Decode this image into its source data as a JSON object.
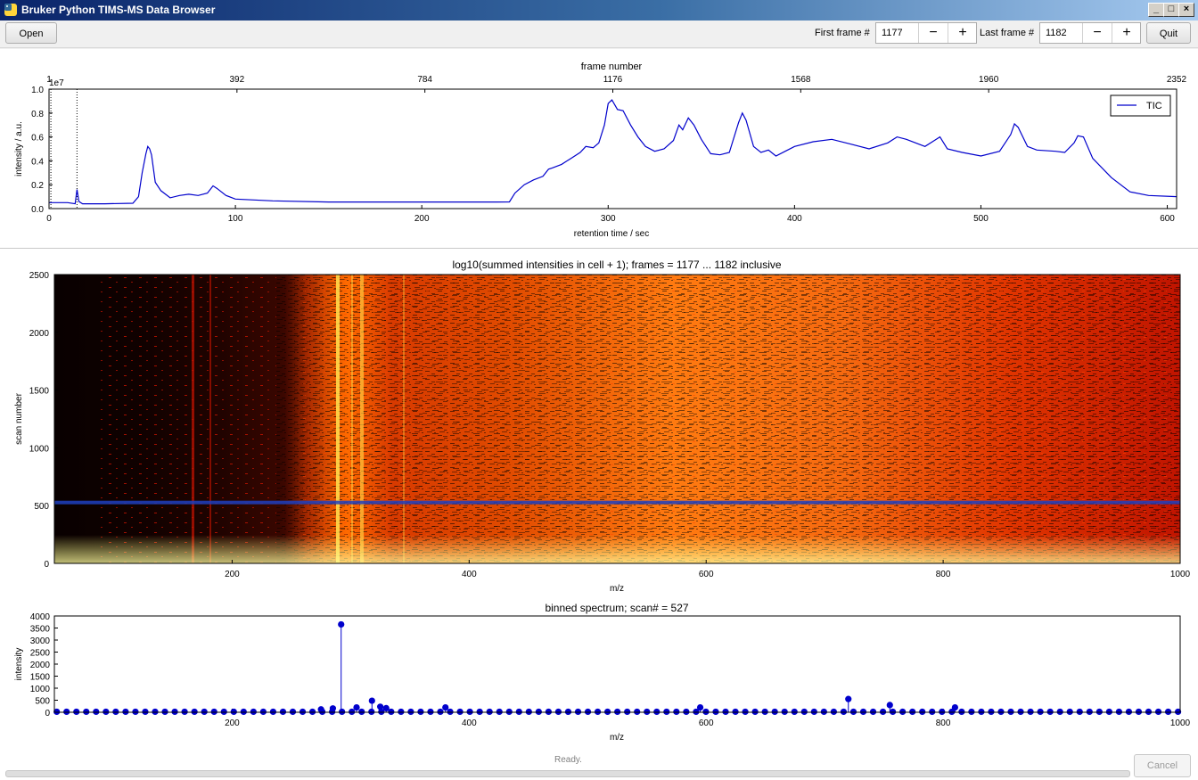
{
  "window": {
    "title": "Bruker Python TIMS-MS Data Browser"
  },
  "toolbar": {
    "open_label": "Open",
    "first_frame_label": "First frame #",
    "first_frame_value": "1177",
    "last_frame_label": "Last frame #",
    "last_frame_value": "1182",
    "minus": "−",
    "plus": "+",
    "quit_label": "Quit"
  },
  "tic_chart": {
    "type": "line",
    "top_xlabel": "frame number",
    "top_ticks": [
      "1",
      "392",
      "784",
      "1176",
      "1568",
      "1960",
      "2352"
    ],
    "xlabel": "retention time / sec",
    "ylabel": "intensity / a.u.",
    "y_scale_label": "1e7",
    "xlim": [
      0,
      605
    ],
    "ylim": [
      0,
      1.0
    ],
    "x_ticks": [
      "0",
      "100",
      "200",
      "300",
      "400",
      "500",
      "600"
    ],
    "y_ticks": [
      "0.0",
      "0.2",
      "0.4",
      "0.6",
      "0.8",
      "1.0"
    ],
    "legend": "TIC",
    "legend_position": "top-right",
    "color": "#0000cc",
    "marker_lines": [
      1,
      15
    ],
    "x": [
      0,
      10,
      14,
      15,
      16,
      18,
      30,
      45,
      48,
      50,
      52,
      53,
      54,
      55,
      57,
      60,
      65,
      70,
      75,
      80,
      85,
      88,
      90,
      95,
      100,
      120,
      150,
      200,
      240,
      247,
      250,
      255,
      260,
      265,
      268,
      270,
      275,
      280,
      285,
      288,
      292,
      295,
      298,
      300,
      302,
      305,
      308,
      312,
      316,
      320,
      325,
      330,
      335,
      338,
      340,
      343,
      346,
      350,
      355,
      360,
      365,
      370,
      372,
      374,
      378,
      382,
      386,
      390,
      395,
      400,
      410,
      420,
      430,
      440,
      450,
      455,
      460,
      470,
      475,
      478,
      482,
      490,
      500,
      510,
      516,
      518,
      520,
      525,
      530,
      540,
      545,
      550,
      552,
      555,
      560,
      570,
      580,
      590,
      605
    ],
    "y": [
      0.05,
      0.05,
      0.04,
      0.16,
      0.06,
      0.04,
      0.04,
      0.045,
      0.1,
      0.3,
      0.46,
      0.52,
      0.5,
      0.45,
      0.22,
      0.15,
      0.09,
      0.11,
      0.12,
      0.11,
      0.13,
      0.19,
      0.17,
      0.11,
      0.08,
      0.065,
      0.055,
      0.055,
      0.055,
      0.056,
      0.13,
      0.2,
      0.24,
      0.27,
      0.33,
      0.34,
      0.37,
      0.42,
      0.47,
      0.52,
      0.51,
      0.55,
      0.7,
      0.88,
      0.91,
      0.83,
      0.82,
      0.7,
      0.6,
      0.52,
      0.48,
      0.5,
      0.57,
      0.7,
      0.66,
      0.76,
      0.7,
      0.58,
      0.46,
      0.45,
      0.47,
      0.72,
      0.8,
      0.74,
      0.52,
      0.47,
      0.49,
      0.44,
      0.48,
      0.52,
      0.56,
      0.58,
      0.54,
      0.5,
      0.55,
      0.6,
      0.58,
      0.52,
      0.57,
      0.6,
      0.5,
      0.47,
      0.44,
      0.48,
      0.62,
      0.71,
      0.68,
      0.52,
      0.49,
      0.48,
      0.47,
      0.55,
      0.61,
      0.6,
      0.42,
      0.26,
      0.14,
      0.11,
      0.1
    ]
  },
  "heatmap_chart": {
    "type": "heatmap",
    "title": "log10(summed intensities in cell + 1); frames = 1177 ... 1182 inclusive",
    "xlabel": "m/z",
    "ylabel": "scan number",
    "xlim": [
      50,
      1000
    ],
    "ylim": [
      0,
      2500
    ],
    "x_ticks": [
      "200",
      "400",
      "600",
      "800",
      "1000"
    ],
    "y_ticks": [
      "0",
      "500",
      "1000",
      "1500",
      "2000",
      "2500"
    ],
    "selected_scan": 527,
    "selection_color": "#1f3fbf"
  },
  "spectrum_chart": {
    "type": "scatter",
    "title": "binned spectrum; scan# = 527",
    "xlabel": "m/z",
    "ylabel": "intensity",
    "xlim": [
      50,
      1000
    ],
    "ylim": [
      0,
      4000
    ],
    "x_ticks": [
      "200",
      "400",
      "600",
      "800",
      "1000"
    ],
    "y_ticks": [
      "0",
      "500",
      "1000",
      "1500",
      "2000",
      "2500",
      "3000",
      "3500",
      "4000"
    ],
    "color": "#0000cc",
    "peaks_mz": [
      275,
      285,
      292,
      305,
      318,
      325,
      330,
      380,
      595,
      720,
      755,
      810
    ],
    "peaks_intensity": [
      120,
      160,
      3650,
      200,
      480,
      230,
      170,
      200,
      200,
      550,
      300,
      200
    ]
  },
  "status": {
    "text": "Ready.",
    "cancel_label": "Cancel"
  }
}
